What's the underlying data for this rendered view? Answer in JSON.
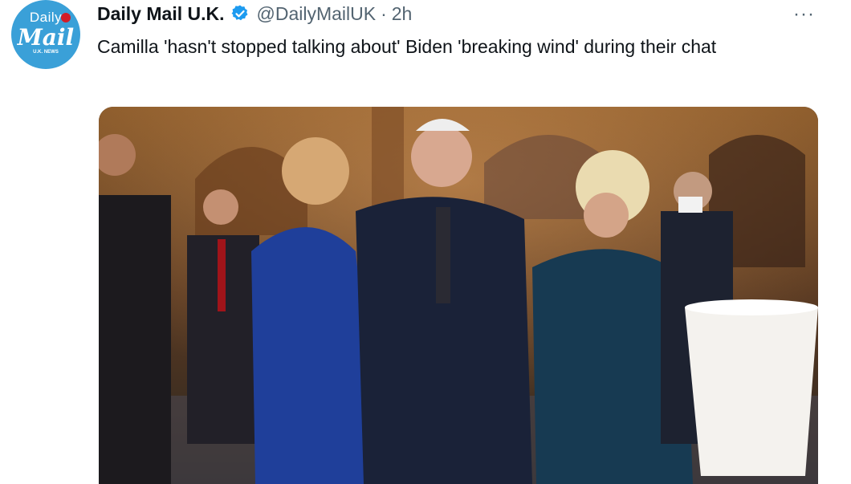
{
  "tweet": {
    "author_name": "Daily Mail U.K.",
    "handle": "@DailyMailUK",
    "separator": "·",
    "time": "2h",
    "text": "Camilla 'hasn't stopped talking about' Biden 'breaking wind' during their chat",
    "more_label": "···"
  },
  "avatar": {
    "line1": "Daily",
    "line2": "Mail",
    "line3": "U.K. NEWS"
  },
  "icons": {
    "verified": "verified-badge-icon",
    "more": "more-horizontal-icon"
  },
  "colors": {
    "avatar_bg": "#3aa0d8",
    "verified": "#1d9bf0",
    "text_primary": "#0f1419",
    "text_secondary": "#536471"
  }
}
